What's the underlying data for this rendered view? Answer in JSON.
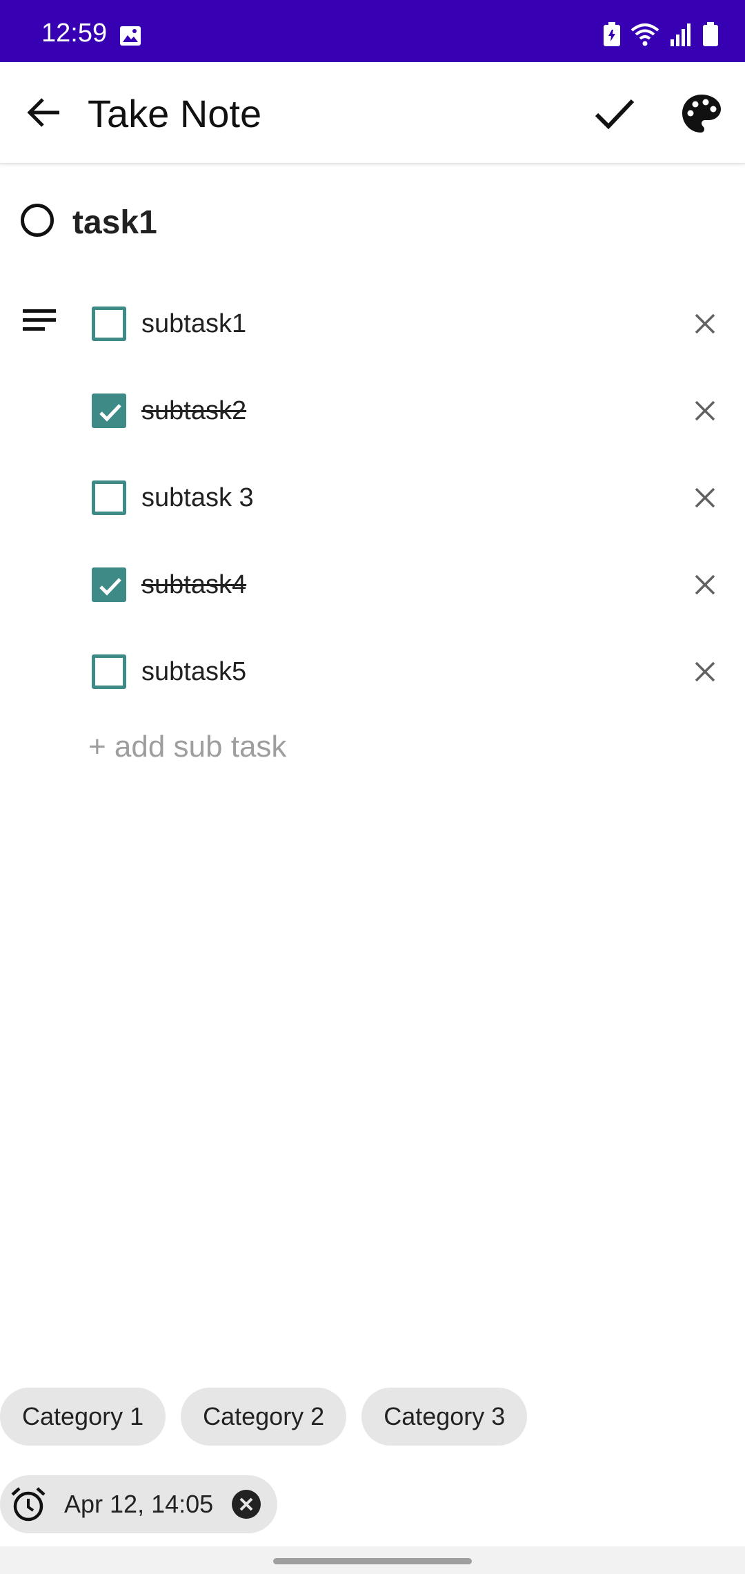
{
  "status_bar": {
    "time": "12:59",
    "icons": [
      "gallery-icon",
      "battery-saver-icon",
      "wifi-icon",
      "signal-icon",
      "battery-icon"
    ]
  },
  "app_bar": {
    "title": "Take Note",
    "icons": [
      "back-arrow-icon",
      "check-icon",
      "palette-icon"
    ]
  },
  "task": {
    "title": "task1",
    "completed": false
  },
  "subtasks": [
    {
      "label": "subtask1",
      "checked": false
    },
    {
      "label": "subtask2",
      "checked": true
    },
    {
      "label": "subtask 3",
      "checked": false
    },
    {
      "label": "subtask4",
      "checked": true
    },
    {
      "label": "subtask5",
      "checked": false
    }
  ],
  "add_subtask_label": "+ add sub task",
  "categories": [
    "Category 1",
    "Category 2",
    "Category 3"
  ],
  "reminder": {
    "label": "Apr 12, 14:05"
  },
  "colors": {
    "status_bar": "#3700b3",
    "checkbox_accent": "#3e8a87",
    "chip_background": "#e6e6e6",
    "placeholder_text": "#9e9e9e"
  }
}
